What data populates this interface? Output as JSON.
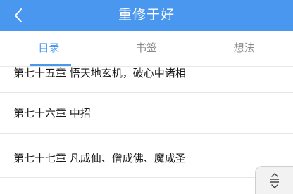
{
  "header": {
    "title": "重修于好",
    "background": "#4a97ef"
  },
  "tabs": [
    {
      "label": "目录",
      "active": true
    },
    {
      "label": "书签",
      "active": false
    },
    {
      "label": "想法",
      "active": false
    }
  ],
  "chapters": [
    {
      "label": "第七十五章 悟天地玄机，破心中诸相"
    },
    {
      "label": "第七十六章 中招"
    },
    {
      "label": "第七十七章 凡成仙、僧成佛、魔成圣"
    }
  ],
  "icons": {
    "back": "chevron-left-icon",
    "scroll": "scroll-handle-icon"
  },
  "colors": {
    "accent": "#4a97ef",
    "text": "#1a1a1a",
    "tab_inactive": "#888888"
  }
}
